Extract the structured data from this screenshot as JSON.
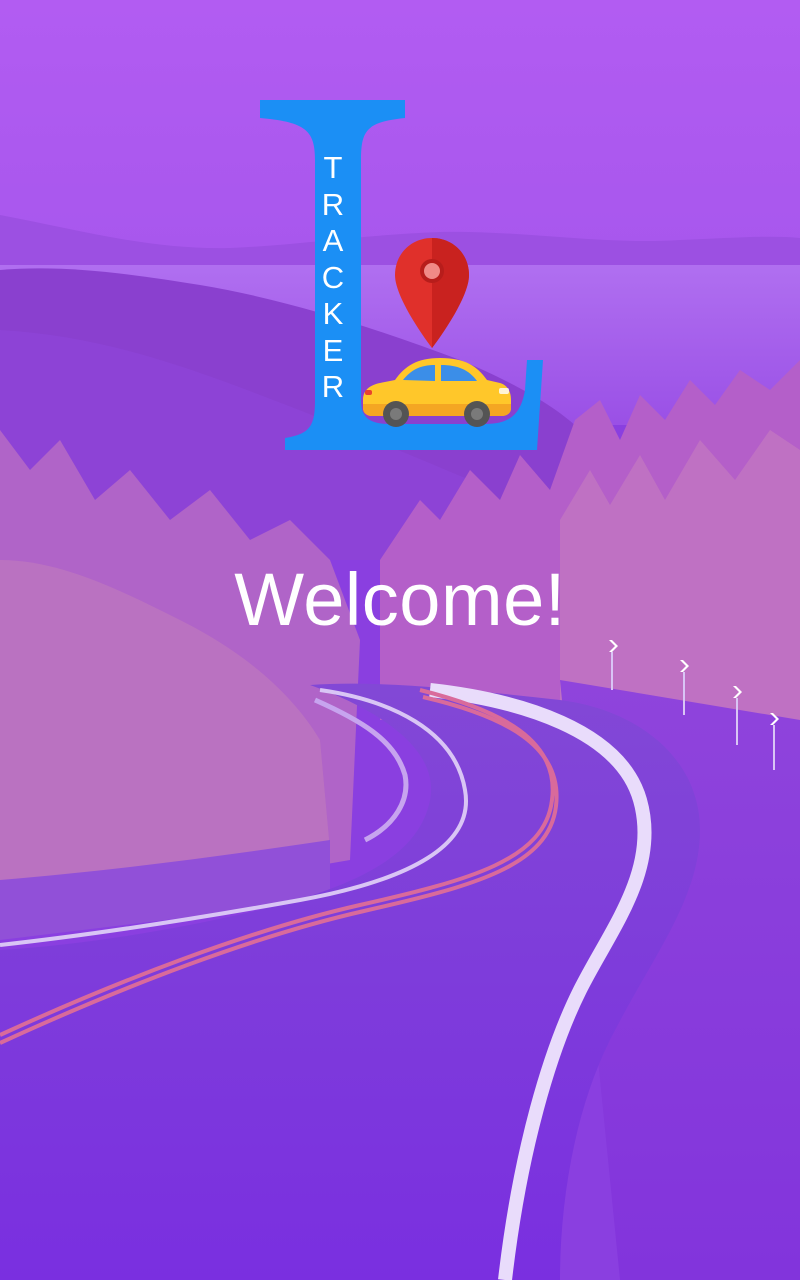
{
  "splash": {
    "brand_letter": "L",
    "brand_word": "TRACKER",
    "brand_word_letters": [
      "T",
      "R",
      "A",
      "C",
      "K",
      "E",
      "R"
    ],
    "welcome_text": "Welcome!"
  },
  "colors": {
    "logo_blue": "#1b8ff5",
    "pin_red": "#e0302b",
    "car_yellow": "#ffc72a",
    "overlay_purple": "#8a3fe0",
    "text_white": "#ffffff"
  },
  "icons": {
    "location": "location-pin-icon",
    "vehicle": "car-icon"
  }
}
